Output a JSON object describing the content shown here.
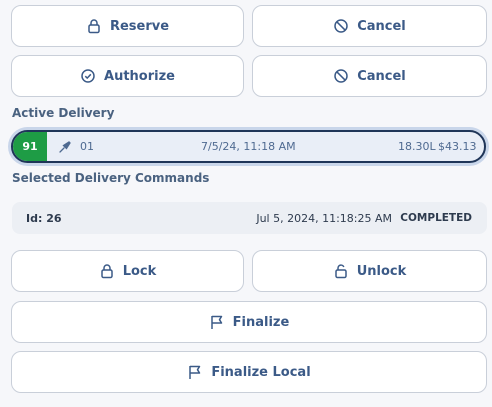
{
  "actions": {
    "reserve_label": "Reserve",
    "cancel_label_1": "Cancel",
    "authorize_label": "Authorize",
    "cancel_label_2": "Cancel"
  },
  "active_delivery": {
    "section_label": "Active Delivery",
    "badge": "91",
    "pump": "01",
    "time": "7/5/24, 11:18 AM",
    "volume": "18.30L",
    "amount": "$43.13",
    "badge_color": "#1e9c45"
  },
  "commands": {
    "section_label": "Selected Delivery Commands",
    "id": "Id: 26",
    "timestamp": "Jul 5, 2024, 11:18:25 AM",
    "status": "COMPLETED"
  },
  "command_buttons": {
    "lock_label": "Lock",
    "unlock_label": "Unlock",
    "finalize_label": "Finalize",
    "finalize_local_label": "Finalize Local"
  }
}
